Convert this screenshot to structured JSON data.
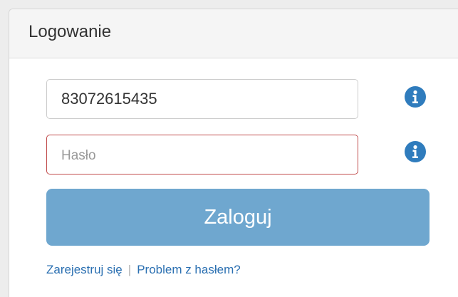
{
  "panel": {
    "title": "Logowanie"
  },
  "form": {
    "login": {
      "value": "83072615435"
    },
    "password": {
      "placeholder": "Hasło",
      "value": ""
    },
    "submit_label": "Zaloguj"
  },
  "links": {
    "register": "Zarejestruj się",
    "separator": "|",
    "password_problem": "Problem z hasłem?"
  },
  "colors": {
    "primary_button": "#6fa7cf",
    "link": "#2a6fb1",
    "error_border": "#c14c4c",
    "info_icon": "#2f7cbd"
  },
  "icons": {
    "info": "info-icon"
  }
}
